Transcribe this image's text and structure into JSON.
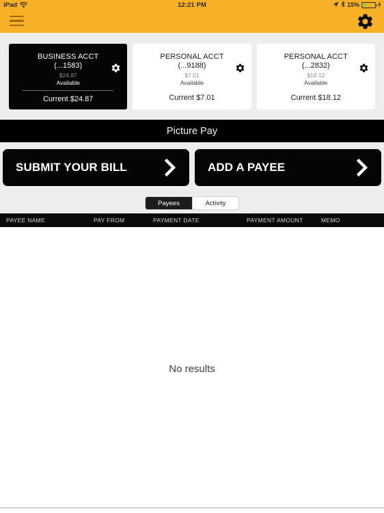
{
  "statusbar": {
    "device": "iPad",
    "wifi_icon": "wifi-icon",
    "time": "12:21 PM",
    "location_icon": "location-arrow-icon",
    "bluetooth_icon": "bluetooth-icon",
    "battery_percent": "15%",
    "charging_icon": "charging-bolt-icon"
  },
  "navbar": {
    "menu_icon": "hamburger-menu-icon",
    "settings_icon": "gear-icon",
    "background_color": "#F8B027"
  },
  "accounts": [
    {
      "name": "BUSINESS ACCT",
      "number": "(...1583)",
      "available_amount": "$24.87",
      "available_label": "Available",
      "current": "Current $24.87",
      "selected": true,
      "gear_icon": "gear-icon"
    },
    {
      "name": "PERSONAL ACCT",
      "number": "(...9188)",
      "available_amount": "$7.01",
      "available_label": "Available",
      "current": "Current $7.01",
      "selected": false,
      "gear_icon": "gear-icon"
    },
    {
      "name": "PERSONAL ACCT",
      "number": "(...2832)",
      "available_amount": "$18.12",
      "available_label": "Available",
      "current": "Current $18.12",
      "selected": false,
      "gear_icon": "gear-icon"
    }
  ],
  "page_title": "Picture Pay",
  "actions": [
    {
      "label": "SUBMIT YOUR BILL",
      "chevron_icon": "chevron-right-icon"
    },
    {
      "label": "ADD A PAYEE",
      "chevron_icon": "chevron-right-icon"
    }
  ],
  "segmented_control": {
    "options": [
      "Payees",
      "Activity"
    ],
    "selected": "Payees"
  },
  "table": {
    "columns": [
      "PAYEE NAME",
      "PAY FROM",
      "PAYMENT DATE",
      "PAYMENT AMOUNT",
      "MEMO"
    ],
    "rows": [],
    "empty_message": "No results"
  },
  "colors": {
    "accent_yellow": "#F8B027",
    "bar_black": "#000000",
    "panel_gray": "#ededed"
  }
}
